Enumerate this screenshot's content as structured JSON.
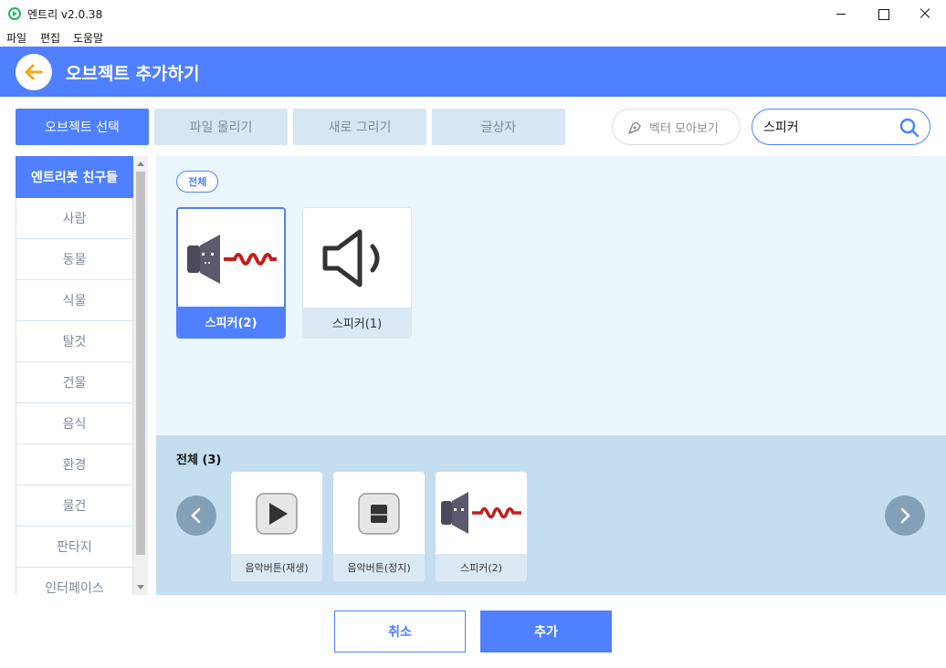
{
  "window": {
    "title": "엔트리 v2.0.38"
  },
  "menu": {
    "items": [
      "파일",
      "편집",
      "도움말"
    ]
  },
  "header": {
    "title": "오브젝트 추가하기"
  },
  "tabs": [
    {
      "label": "오브젝트 선택",
      "active": true
    },
    {
      "label": "파일 올리기",
      "active": false
    },
    {
      "label": "새로 그리기",
      "active": false
    },
    {
      "label": "글상자",
      "active": false
    }
  ],
  "vector": {
    "label": "벡터 모아보기"
  },
  "search": {
    "value": "스피커"
  },
  "categories": [
    "엔트리봇 친구들",
    "사람",
    "동물",
    "식물",
    "탈것",
    "건물",
    "음식",
    "환경",
    "물건",
    "판타지",
    "인터페이스"
  ],
  "filter": {
    "label": "전체"
  },
  "results": [
    {
      "label": "스피커(2)",
      "selected": true,
      "icon": "speaker-robot-icon"
    },
    {
      "label": "스피커(1)",
      "selected": false,
      "icon": "speaker-icon"
    }
  ],
  "selected_strip": {
    "title": "전체 (3)",
    "items": [
      {
        "label": "음악버튼(재생)",
        "icon": "play-button-icon"
      },
      {
        "label": "음악버튼(정지)",
        "icon": "stop-button-icon"
      },
      {
        "label": "스피커(2)",
        "icon": "speaker-robot-icon"
      }
    ]
  },
  "footer": {
    "cancel_label": "취소",
    "add_label": "추가"
  },
  "colors": {
    "accent": "#4f80ff",
    "panel": "#eaf5fc",
    "strip": "#c4def0",
    "tab_inactive": "#d6e6f3"
  }
}
